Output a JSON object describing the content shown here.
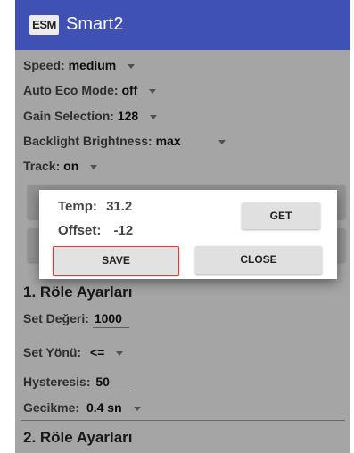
{
  "app": {
    "logo_text": "ESM",
    "title": "Smart2"
  },
  "settings": {
    "speed": {
      "label": "Speed:",
      "value": "medium"
    },
    "auto_eco": {
      "label": "Auto Eco Mode:",
      "value": "off"
    },
    "gain": {
      "label": "Gain Selection:",
      "value": "128"
    },
    "backlight": {
      "label": "Backlight Brightness:",
      "value": "max"
    },
    "track": {
      "label": "Track:",
      "value": "on"
    }
  },
  "relay1": {
    "title": "1. Röle Ayarları",
    "set_value": {
      "label": "Set Değeri:",
      "value": "1000"
    },
    "set_direction": {
      "label": "Set Yönü:",
      "value": "<="
    },
    "hysteresis": {
      "label": "Hysteresis:",
      "value": "50"
    },
    "delay": {
      "label": "Gecikme:",
      "value": "0.4 sn"
    }
  },
  "relay2": {
    "title": "2. Röle Ayarları"
  },
  "dialog": {
    "temp_label": "Temp:",
    "temp_value": "31.2",
    "offset_label": "Offset:",
    "offset_value": "-12",
    "get_label": "GET",
    "save_label": "SAVE",
    "close_label": "CLOSE"
  },
  "colors": {
    "appbar": "#3f51b5",
    "highlight": "#e53935"
  }
}
